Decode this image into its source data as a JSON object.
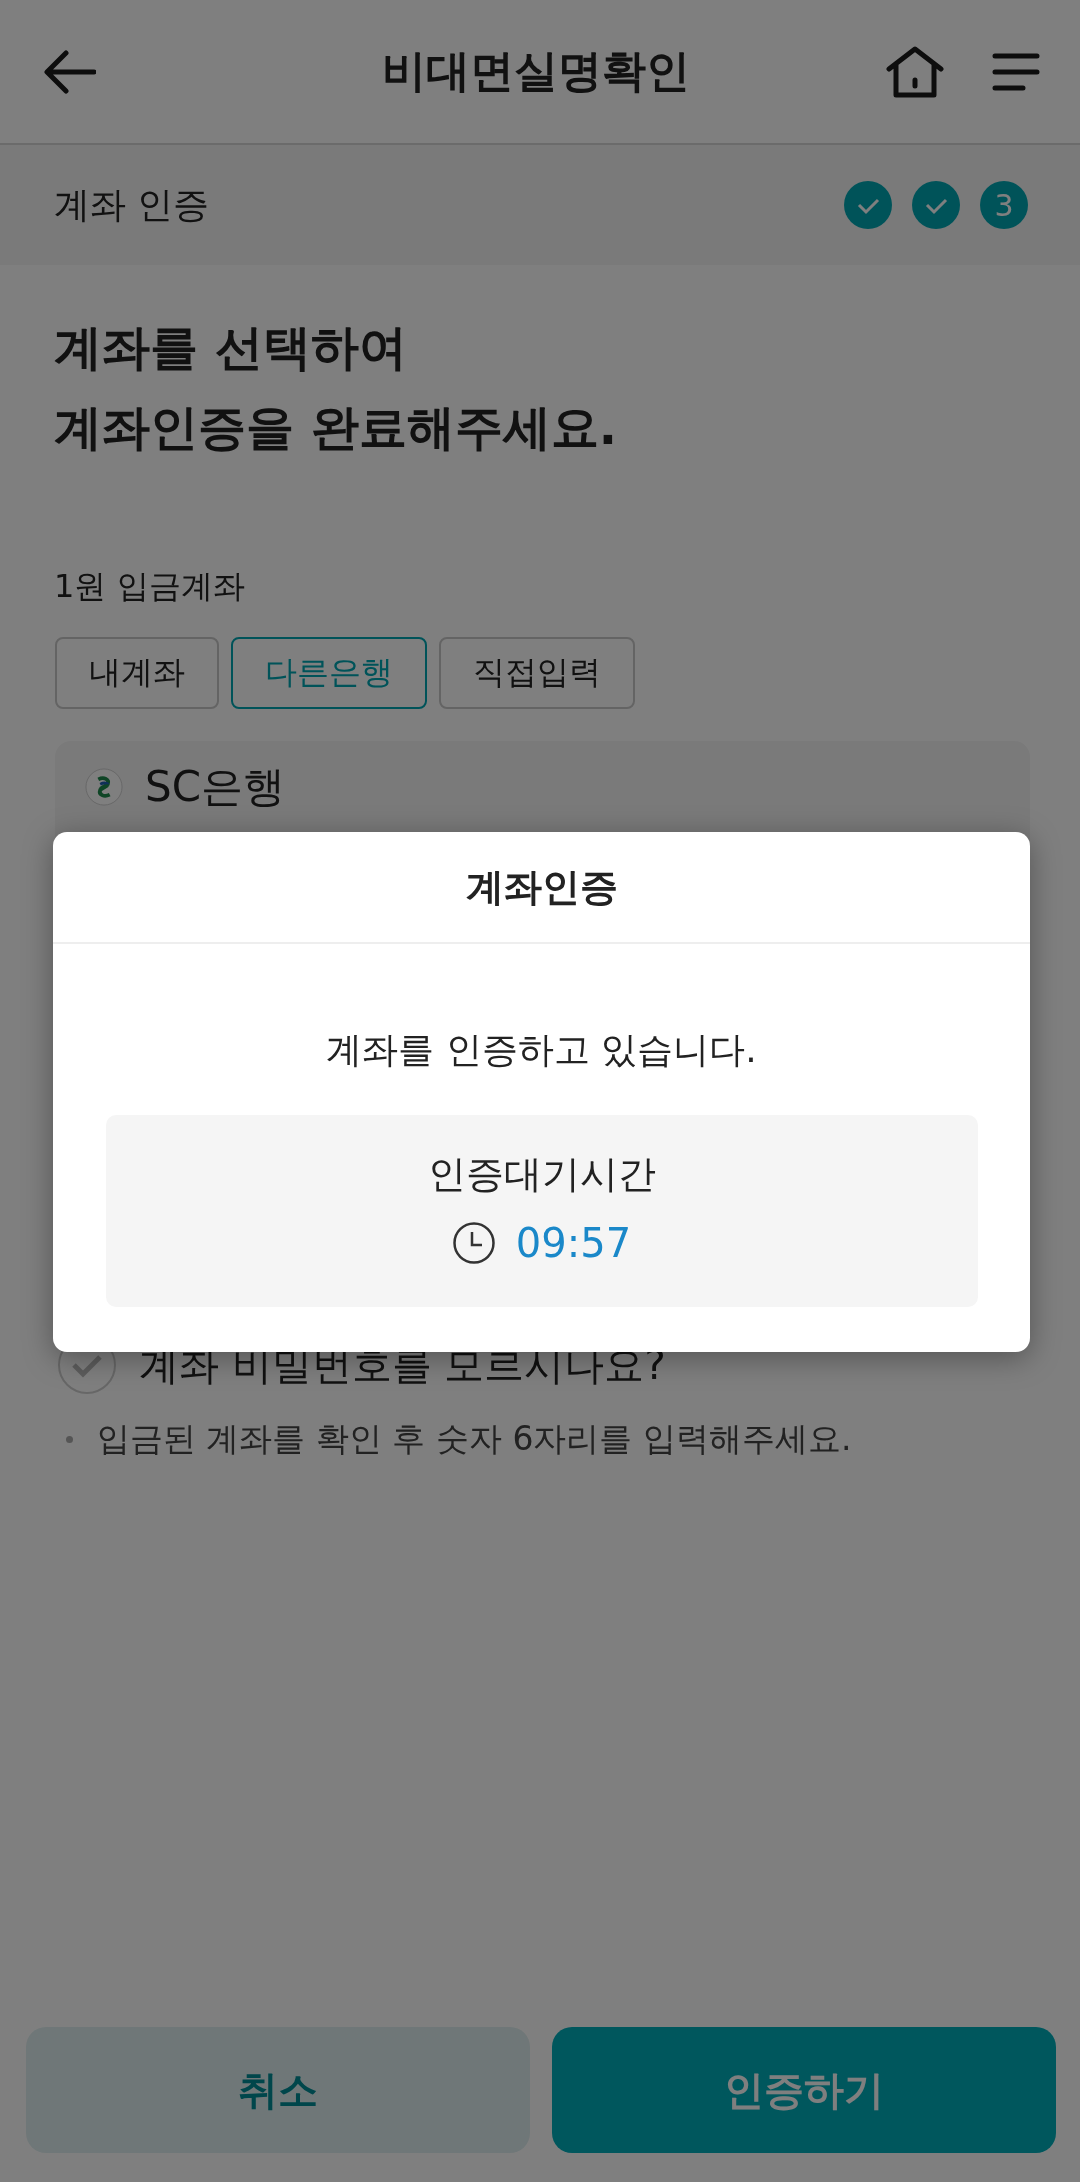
{
  "header": {
    "title": "비대면실명확인"
  },
  "step_bar": {
    "label": "계좌 인증",
    "steps": [
      {
        "kind": "done"
      },
      {
        "kind": "done"
      },
      {
        "kind": "current",
        "label": "3"
      }
    ]
  },
  "heading": [
    "계좌를 선택하여",
    "계좌인증을 완료해주세요."
  ],
  "section_label": "1원 입금계좌",
  "tabs": [
    {
      "label": "내계좌",
      "selected": false
    },
    {
      "label": "다른은행",
      "selected": true
    },
    {
      "label": "직접입력",
      "selected": false
    }
  ],
  "account": {
    "bank": "SC은행"
  },
  "option": {
    "label": "계좌 비밀번호를 모르시나요?",
    "checked": false
  },
  "note": "입금된 계좌를 확인 후 숫자 6자리를 입력해주세요.",
  "buttons": [
    {
      "label": "취소",
      "kind": "secondary"
    },
    {
      "label": "인증하기",
      "kind": "primary"
    }
  ],
  "dialog": {
    "title": "계좌인증",
    "message": "계좌를 인증하고 있습니다.",
    "timer_label": "인증대기시간",
    "timer": "09:57"
  }
}
